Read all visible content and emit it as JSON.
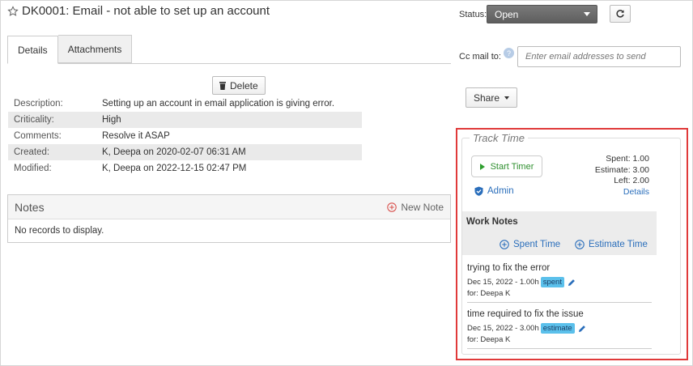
{
  "ticket": {
    "title": "DK0001: Email - not able to set up an account"
  },
  "tabs": [
    {
      "label": "Details",
      "active": true
    },
    {
      "label": "Attachments",
      "active": false
    }
  ],
  "toolbar": {
    "delete_label": "Delete"
  },
  "details": [
    {
      "label": "Description:",
      "value": "Setting up an account in email application is giving error."
    },
    {
      "label": "Criticality:",
      "value": "High"
    },
    {
      "label": "Comments:",
      "value": "Resolve it ASAP"
    },
    {
      "label": "Created:",
      "value": "K, Deepa on 2020-02-07 06:31 AM"
    },
    {
      "label": "Modified:",
      "value": "K, Deepa on 2022-12-15 02:47 PM"
    }
  ],
  "notes": {
    "title": "Notes",
    "new_note_label": "New Note",
    "empty_text": "No records to display."
  },
  "status": {
    "label": "Status:",
    "value": "Open"
  },
  "cc": {
    "label": "Cc mail to:",
    "help_glyph": "?",
    "placeholder": "Enter email addresses to send"
  },
  "share": {
    "label": "Share"
  },
  "track_time": {
    "legend": "Track Time",
    "start_timer_label": "Start Timer",
    "spent": "Spent: 1.00",
    "estimate": "Estimate: 3.00",
    "left": "Left: 2.00",
    "details_link": "Details",
    "user": "Admin",
    "work_notes_title": "Work Notes",
    "spent_time_link": "Spent Time",
    "estimate_time_link": "Estimate Time",
    "entries": [
      {
        "title": "trying to fix the error",
        "meta": "Dec 15, 2022 - 1.00h",
        "tag": "spent",
        "for": "for: Deepa K"
      },
      {
        "title": "time required to fix the issue",
        "meta": "Dec 15, 2022 - 3.00h",
        "tag": "estimate",
        "for": "for: Deepa K"
      }
    ]
  },
  "colors": {
    "highlight": "#e03a3a",
    "link": "#2a6ebb",
    "tag_bg": "#5bc0eb",
    "status_bg": "#6b6b6b",
    "timer_green": "#2e9e2e"
  }
}
